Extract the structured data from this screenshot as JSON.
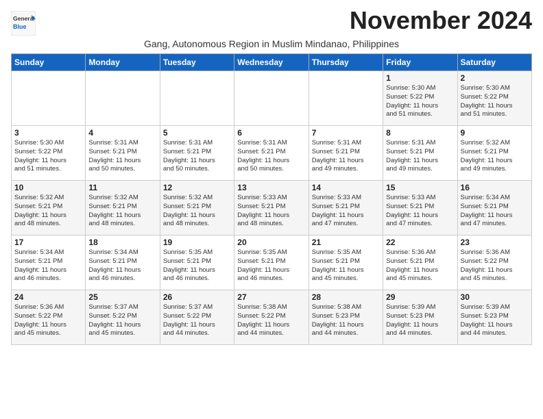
{
  "logo": {
    "general": "General",
    "blue": "Blue"
  },
  "title": "November 2024",
  "subtitle": "Gang, Autonomous Region in Muslim Mindanao, Philippines",
  "days_header": [
    "Sunday",
    "Monday",
    "Tuesday",
    "Wednesday",
    "Thursday",
    "Friday",
    "Saturday"
  ],
  "weeks": [
    [
      {
        "day": "",
        "info": ""
      },
      {
        "day": "",
        "info": ""
      },
      {
        "day": "",
        "info": ""
      },
      {
        "day": "",
        "info": ""
      },
      {
        "day": "",
        "info": ""
      },
      {
        "day": "1",
        "info": "Sunrise: 5:30 AM\nSunset: 5:22 PM\nDaylight: 11 hours\nand 51 minutes."
      },
      {
        "day": "2",
        "info": "Sunrise: 5:30 AM\nSunset: 5:22 PM\nDaylight: 11 hours\nand 51 minutes."
      }
    ],
    [
      {
        "day": "3",
        "info": "Sunrise: 5:30 AM\nSunset: 5:22 PM\nDaylight: 11 hours\nand 51 minutes."
      },
      {
        "day": "4",
        "info": "Sunrise: 5:31 AM\nSunset: 5:21 PM\nDaylight: 11 hours\nand 50 minutes."
      },
      {
        "day": "5",
        "info": "Sunrise: 5:31 AM\nSunset: 5:21 PM\nDaylight: 11 hours\nand 50 minutes."
      },
      {
        "day": "6",
        "info": "Sunrise: 5:31 AM\nSunset: 5:21 PM\nDaylight: 11 hours\nand 50 minutes."
      },
      {
        "day": "7",
        "info": "Sunrise: 5:31 AM\nSunset: 5:21 PM\nDaylight: 11 hours\nand 49 minutes."
      },
      {
        "day": "8",
        "info": "Sunrise: 5:31 AM\nSunset: 5:21 PM\nDaylight: 11 hours\nand 49 minutes."
      },
      {
        "day": "9",
        "info": "Sunrise: 5:32 AM\nSunset: 5:21 PM\nDaylight: 11 hours\nand 49 minutes."
      }
    ],
    [
      {
        "day": "10",
        "info": "Sunrise: 5:32 AM\nSunset: 5:21 PM\nDaylight: 11 hours\nand 48 minutes."
      },
      {
        "day": "11",
        "info": "Sunrise: 5:32 AM\nSunset: 5:21 PM\nDaylight: 11 hours\nand 48 minutes."
      },
      {
        "day": "12",
        "info": "Sunrise: 5:32 AM\nSunset: 5:21 PM\nDaylight: 11 hours\nand 48 minutes."
      },
      {
        "day": "13",
        "info": "Sunrise: 5:33 AM\nSunset: 5:21 PM\nDaylight: 11 hours\nand 48 minutes."
      },
      {
        "day": "14",
        "info": "Sunrise: 5:33 AM\nSunset: 5:21 PM\nDaylight: 11 hours\nand 47 minutes."
      },
      {
        "day": "15",
        "info": "Sunrise: 5:33 AM\nSunset: 5:21 PM\nDaylight: 11 hours\nand 47 minutes."
      },
      {
        "day": "16",
        "info": "Sunrise: 5:34 AM\nSunset: 5:21 PM\nDaylight: 11 hours\nand 47 minutes."
      }
    ],
    [
      {
        "day": "17",
        "info": "Sunrise: 5:34 AM\nSunset: 5:21 PM\nDaylight: 11 hours\nand 46 minutes."
      },
      {
        "day": "18",
        "info": "Sunrise: 5:34 AM\nSunset: 5:21 PM\nDaylight: 11 hours\nand 46 minutes."
      },
      {
        "day": "19",
        "info": "Sunrise: 5:35 AM\nSunset: 5:21 PM\nDaylight: 11 hours\nand 46 minutes."
      },
      {
        "day": "20",
        "info": "Sunrise: 5:35 AM\nSunset: 5:21 PM\nDaylight: 11 hours\nand 46 minutes."
      },
      {
        "day": "21",
        "info": "Sunrise: 5:35 AM\nSunset: 5:21 PM\nDaylight: 11 hours\nand 45 minutes."
      },
      {
        "day": "22",
        "info": "Sunrise: 5:36 AM\nSunset: 5:21 PM\nDaylight: 11 hours\nand 45 minutes."
      },
      {
        "day": "23",
        "info": "Sunrise: 5:36 AM\nSunset: 5:22 PM\nDaylight: 11 hours\nand 45 minutes."
      }
    ],
    [
      {
        "day": "24",
        "info": "Sunrise: 5:36 AM\nSunset: 5:22 PM\nDaylight: 11 hours\nand 45 minutes."
      },
      {
        "day": "25",
        "info": "Sunrise: 5:37 AM\nSunset: 5:22 PM\nDaylight: 11 hours\nand 45 minutes."
      },
      {
        "day": "26",
        "info": "Sunrise: 5:37 AM\nSunset: 5:22 PM\nDaylight: 11 hours\nand 44 minutes."
      },
      {
        "day": "27",
        "info": "Sunrise: 5:38 AM\nSunset: 5:22 PM\nDaylight: 11 hours\nand 44 minutes."
      },
      {
        "day": "28",
        "info": "Sunrise: 5:38 AM\nSunset: 5:23 PM\nDaylight: 11 hours\nand 44 minutes."
      },
      {
        "day": "29",
        "info": "Sunrise: 5:39 AM\nSunset: 5:23 PM\nDaylight: 11 hours\nand 44 minutes."
      },
      {
        "day": "30",
        "info": "Sunrise: 5:39 AM\nSunset: 5:23 PM\nDaylight: 11 hours\nand 44 minutes."
      }
    ]
  ]
}
